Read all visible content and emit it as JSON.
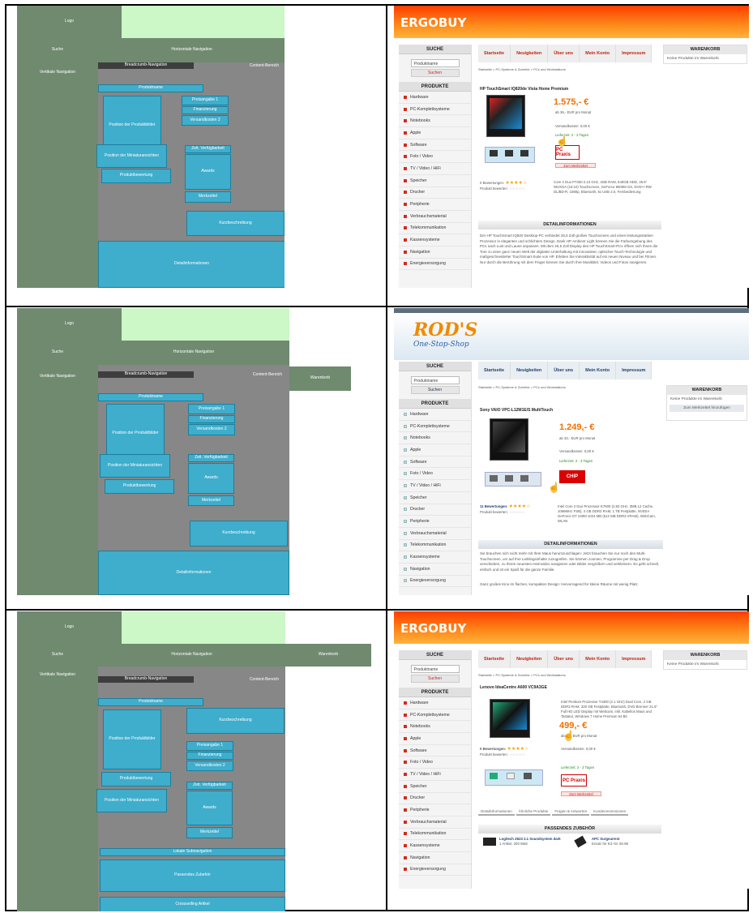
{
  "wireframe": {
    "logo": "Logo",
    "search": "Suche",
    "horizontal_nav": "Horizontale Navigation",
    "cart": "Warenkorb",
    "vertical_nav": "Vertikale Navigation",
    "breadcrumb_nav": "Breadcrumb-Navigation",
    "content_area": "Content-Bereich",
    "product_name": "Produktname",
    "product_image_position": "Position der Produktbilder",
    "price_info_1": "Preisangabe 1",
    "financing": "Finanzierung",
    "shipping_cost_2": "Versandkosten 2",
    "mini_image_position": "Position der Miniaturansichten",
    "delivery_availability": "Zeit. Verfügbarkeit",
    "awards": "Awards",
    "product_rating": "Produktbewertung",
    "watchlist": "Merkzettel",
    "short_description": "Kurzbeschreibung",
    "detail_info": "Detailinformationen",
    "lower_sub_nav": "Lokale Subnavigation",
    "matching_accessories": "Passendes Zubehör",
    "cross_selling": "Crossselling Artikel"
  },
  "ergobuy1": {
    "logo": "ERGOBUY",
    "search_title": "SUCHE",
    "search_placeholder": "Produktname",
    "search_button": "Suchen",
    "products_title": "PRODUKTE",
    "categories": [
      "Hardware",
      "PC-Komplettsysteme",
      "Notebooks",
      "Apple",
      "Software",
      "Foto / Video",
      "TV / Video / HiFi",
      "Speicher",
      "Drucker",
      "Peripherie",
      "Verbrauchsmaterial",
      "Telekommunikation",
      "Kassensysteme",
      "Navigation",
      "Energieversorgung"
    ],
    "nav": [
      "Startseite",
      "Neuigkeiten",
      "Über uns",
      "Mein Konto",
      "Impressum"
    ],
    "cart_title": "WARENKORB",
    "cart_text": "Keine Produkte im Warenkorb",
    "breadcrumb": "Startseite > PC-Systeme & Zubehör > PCs und Workstations",
    "product_title": "HP TouchSmart IQ820de Vista Home Premium",
    "price": "1.575,- €",
    "financing": "ab 36,- EUR pro Monat",
    "shipping": "Versandkosten: 0,00 €",
    "delivery": "Lieferzeit: 2 - 3 Tagen",
    "award": "PC Praxis",
    "watchlist": "Zum Merkzettel",
    "ratings": "0 Bewertungen:",
    "rate_product": "Produkt bewerten:",
    "short_desc": "Core 2 Duo P7450 2.13 GHz, 4GB RAM, 640GB HDD, 25.5\" WUXGA (16:10) Touchscreen, GeForce 9600M GS, DVD+/-RW DL/BD-R, 1080p, Bluetooth, 5x USB 2.0, Fernbedienung",
    "detail_title": "DETAILINFORMATIONEN",
    "detail_text": "Der HP TouchSmart IQ820 Desktop-PC verbindet 25,5 Zoll großes Touchscreen und einen leistungsstarken Prozessor in eleganten und schlichtem Design. Dank HP Ambient Light können Sie die Farbumgebung des PCs nach Lust und Laune anpassen. Mit dem 25,5 Zoll Display des HP TouchSmart-PCs öffnen sich Ihnen die Tore zu einer ganz neuen Welt der digitalen Unterhaltung mit innovativer, optischer Touch-Technologie und maßgeschneiderter TouchSmart-Suite von HP. Erleben Sie Interaktivität auf ein neuen Niveau und bei Filmen. Nur durch die Berührung mit dem Finger können Sie durch Ihre Musiktitel, Videos und Fotos navigieren."
  },
  "rods": {
    "logo": "ROD'S",
    "logo_sub": "One-Stop-Shop",
    "search_title": "SUCHE",
    "search_placeholder": "Produktname",
    "search_button": "Suchen",
    "products_title": "PRODUKTE",
    "categories": [
      "Hardware",
      "PC-Komplettsysteme",
      "Notebooks",
      "Apple",
      "Software",
      "Foto / Video",
      "TV / Video / HiFi",
      "Speicher",
      "Drucker",
      "Peripherie",
      "Verbrauchsmaterial",
      "Telekommunikation",
      "Kassensysteme",
      "Navigation",
      "Energieversorgung"
    ],
    "nav": [
      "Startseite",
      "Neuigkeiten",
      "Über uns",
      "Mein Konto",
      "Impressum"
    ],
    "cart_title": "WARENKORB",
    "cart_text": "Keine Produkte im Warenkorb",
    "cart_button": "Zum Merkzettel hinzufügen",
    "breadcrumb": "Startseite > PC-Systeme & Zubehör > PCs und Workstations",
    "product_title": "Sony VAIO VPC-L12M1E/S MultiTouch",
    "price": "1.249,- €",
    "financing": "ab 32,- EUR pro Monat",
    "shipping": "Versandkosten: 0,00 €",
    "delivery": "Lieferzeit: 2 - 3 Tagen",
    "award": "CHIP",
    "ratings": "11 Bewertungen:",
    "rate_product": "Produkt bewerten:",
    "short_desc": "Intel Core 2 Duo Prozessor E7600 (2,93 GHz, 3MB L2 Cache, 1066MHz FSB), 4 GB DDR2 RAM, 1 TB Festplatte, NVIDIA GeForce GT 240M 1024 MB (512 MB DDR3 VRAM), WebCam, WLAN",
    "detail_title": "DETAILINFORMATIONEN",
    "detail_text": "Sie brauchen sich nicht mehr mit Ihrer Maus herumzuschlagen: Jetzt brauchen Sie nur noch den Multi-Touchscreen, um auf Ihre Lieblingsinhalte zuzugreifen. Sie können zoomen, Programme per Drag & Drop verschieben, zu Ihrem neuesten Heimvideo navigieren oder Bilder vergrößern und verkleinern. Es geht schnell, einfach und ist ein Spaß für die ganze Familie.",
    "detail_text_2": "Ganz großes Kino im flachen, kompakten Design: Hervorragend für kleine Räume mit wenig Platz."
  },
  "ergobuy2": {
    "logo": "ERGOBUY",
    "search_title": "SUCHE",
    "search_placeholder": "Produktname",
    "search_button": "Suchen",
    "products_title": "PRODUKTE",
    "categories": [
      "Hardware",
      "PC-Komplettsysteme",
      "Notebooks",
      "Apple",
      "Software",
      "Foto / Video",
      "TV / Video / HiFi",
      "Speicher",
      "Drucker",
      "Peripherie",
      "Verbrauchsmaterial",
      "Telekommunikation",
      "Kassensysteme",
      "Navigation",
      "Energieversorgung"
    ],
    "nav": [
      "Startseite",
      "Neuigkeiten",
      "Über uns",
      "Mein Konto",
      "Impressum"
    ],
    "cart_title": "WARENKORB",
    "cart_text": "Keine Produkte im Warenkorb",
    "breadcrumb": "Startseite > PC-Systeme & Zubehör > PCs und Workstations",
    "product_title": "Lenovo IdeaCentre A600 VC9A3GE",
    "short_desc": "Intel Pentium Prozessor T4300 (2.1 GHz) Dual Core, 2 GB DDR3 RAM, 320 GB Festplatte, Bluetooth, DVD Brenner 21.5\" Full HD LED Display mit Webcam, inkl. Kabellos Maus und Tastatur, Windows 7 Home Premium 64 Bit",
    "price": "499,- €",
    "financing": "ab 25,- EUR pro Monat",
    "shipping": "Versandkosten: 0,00 €",
    "delivery": "Lieferzeit: 2 - 3 Tagen",
    "award": "PC Praxis",
    "watchlist": "Zum Merkzettel",
    "ratings": "0 Bewertungen:",
    "rate_product": "Produkt bewerten:",
    "tabs": [
      "Detailinformationen",
      "Ähnliche Produkte",
      "Fragen & Antworten",
      "Kundenrezensionen"
    ],
    "accessories_title": "PASSENDES ZUBEHÖR",
    "acc1_title": "Logitech Z623 2.1 Soundsystem dark",
    "acc1_price": "1 Artikel, 200 Watt",
    "acc2_title": "APC Surgearrest",
    "acc2_price": "Ersatz für Kd.-Nr. 50.98"
  }
}
